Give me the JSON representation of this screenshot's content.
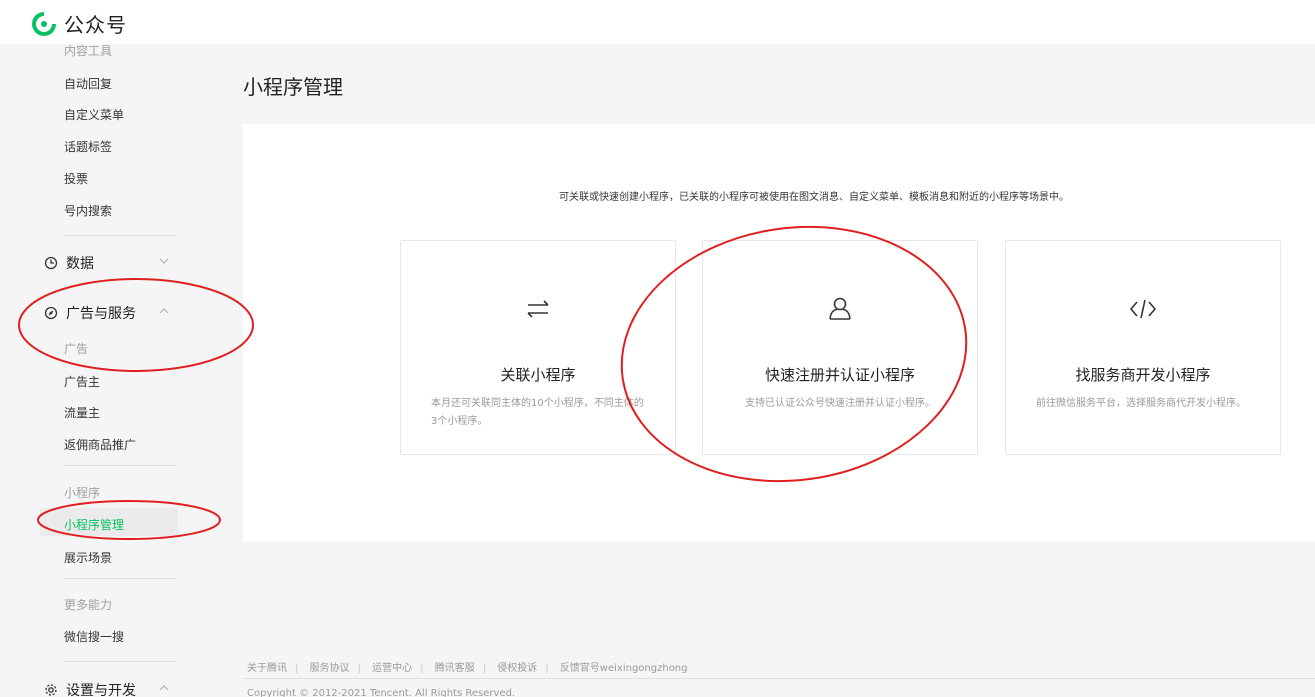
{
  "app": {
    "logo_text": "公众号"
  },
  "sidebar": {
    "partial_item": "内容工具",
    "content_items": [
      "自动回复",
      "自定义菜单",
      "话题标签",
      "投票",
      "号内搜索"
    ],
    "data_group": "数据",
    "ads_group": "广告与服务",
    "ads_section": "广告",
    "ads_items": [
      "广告主",
      "流量主",
      "返佣商品推广"
    ],
    "mp_section": "小程序",
    "mp_items": [
      "小程序管理",
      "展示场景"
    ],
    "more_section": "更多能力",
    "more_items": [
      "微信搜一搜"
    ],
    "settings_group": "设置与开发"
  },
  "main": {
    "title": "小程序管理",
    "description": "可关联或快速创建小程序，已关联的小程序可被使用在图文消息、自定义菜单、模板消息和附近的小程序等场景中。",
    "cards": [
      {
        "icon": "link-arrows-icon",
        "title": "关联小程序",
        "desc": "本月还可关联同主体的10个小程序，不同主体的3个小程序。"
      },
      {
        "icon": "user-outline-icon",
        "title": "快速注册并认证小程序",
        "desc": "支持已认证公众号快速注册并认证小程序。"
      },
      {
        "icon": "code-icon",
        "title": "找服务商开发小程序",
        "desc": "前往微信服务平台，选择服务商代开发小程序。"
      }
    ]
  },
  "footer": {
    "links": [
      "关于腾讯",
      "服务协议",
      "运营中心",
      "腾讯客服",
      "侵权投诉",
      "反馈官号weixingongzhong"
    ],
    "copyright": "Copyright © 2012-2021 Tencent. All Rights Reserved."
  },
  "colors": {
    "accent": "#07c160",
    "annotation": "#e02020"
  }
}
